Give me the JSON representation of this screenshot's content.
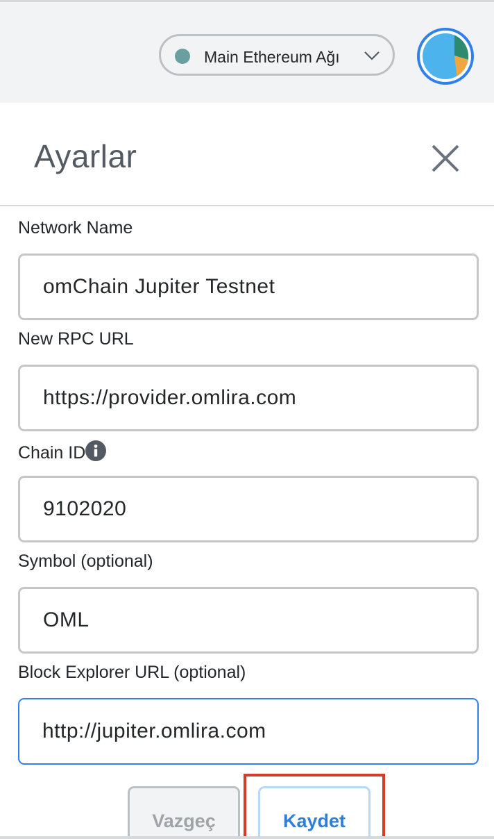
{
  "topbar": {
    "network_label": "Main Ethereum Ağı",
    "network_dot_color": "#6a9fa0",
    "accent_color": "#2f80ed"
  },
  "header": {
    "title": "Ayarlar",
    "close_icon": "close-icon"
  },
  "form": {
    "network_name": {
      "label": "Network Name",
      "value": "omChain Jupiter Testnet"
    },
    "rpc_url": {
      "label": "New RPC URL",
      "value": "https://provider.omlira.com"
    },
    "chain_id": {
      "label": "Chain ID",
      "value": "9102020",
      "icon": "info-icon"
    },
    "symbol": {
      "label": "Symbol (optional)",
      "value": "OML"
    },
    "explorer_url": {
      "label": "Block Explorer URL (optional)",
      "value": "http://jupiter.omlira.com"
    }
  },
  "actions": {
    "cancel_label": "Vazgeç",
    "save_label": "Kaydet",
    "highlight_color": "#d43b28"
  }
}
